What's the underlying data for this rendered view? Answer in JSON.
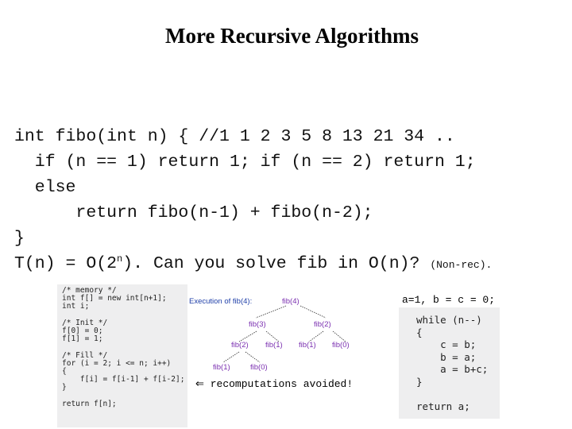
{
  "slide": {
    "title": "More Recursive Algorithms",
    "code_lines": [
      "int fibo(int n) { //1 1 2 3 5 8 13 21 34 ..",
      "  if (n == 1) return 1; if (n == 2) return 1;",
      "  else",
      "      return fibo(n-1) + fibo(n-2);",
      "}"
    ],
    "complexity": {
      "prefix": "T(n) = O(2",
      "superscript": "n",
      "suffix": "). Can you solve fib in O(n)? ",
      "note": "(Non-rec)."
    },
    "dp_code_lines": [
      "/* memory */",
      "int f[] = new int[n+1];",
      "int i;",
      "",
      "/* Init */",
      "f[0] = 0;",
      "f[1] = 1;",
      "",
      "/* Fill */",
      "for (i = 2; i <= n; i++)",
      "{",
      "    f[i] = f[i-1] + f[i-2];",
      "}",
      "",
      "return f[n];"
    ],
    "tree": {
      "caption": "Execution of fib(4):",
      "nodes": [
        "fib(4)",
        "fib(3)",
        "fib(2)",
        "fib(2)",
        "fib(1)",
        "fib(1)",
        "fib(0)",
        "fib(1)",
        "fib(0)"
      ]
    },
    "arrow_note": {
      "icon": "left-arrow-icon",
      "arrow": "⇐",
      "text": "recomputations avoided!"
    },
    "vars_line": "a=1, b = c = 0;",
    "iter_code_lines": [
      "while (n--)",
      "{",
      "    c = b;",
      "    b = a;",
      "    a = b+c;",
      "}",
      "",
      "return a;"
    ]
  }
}
